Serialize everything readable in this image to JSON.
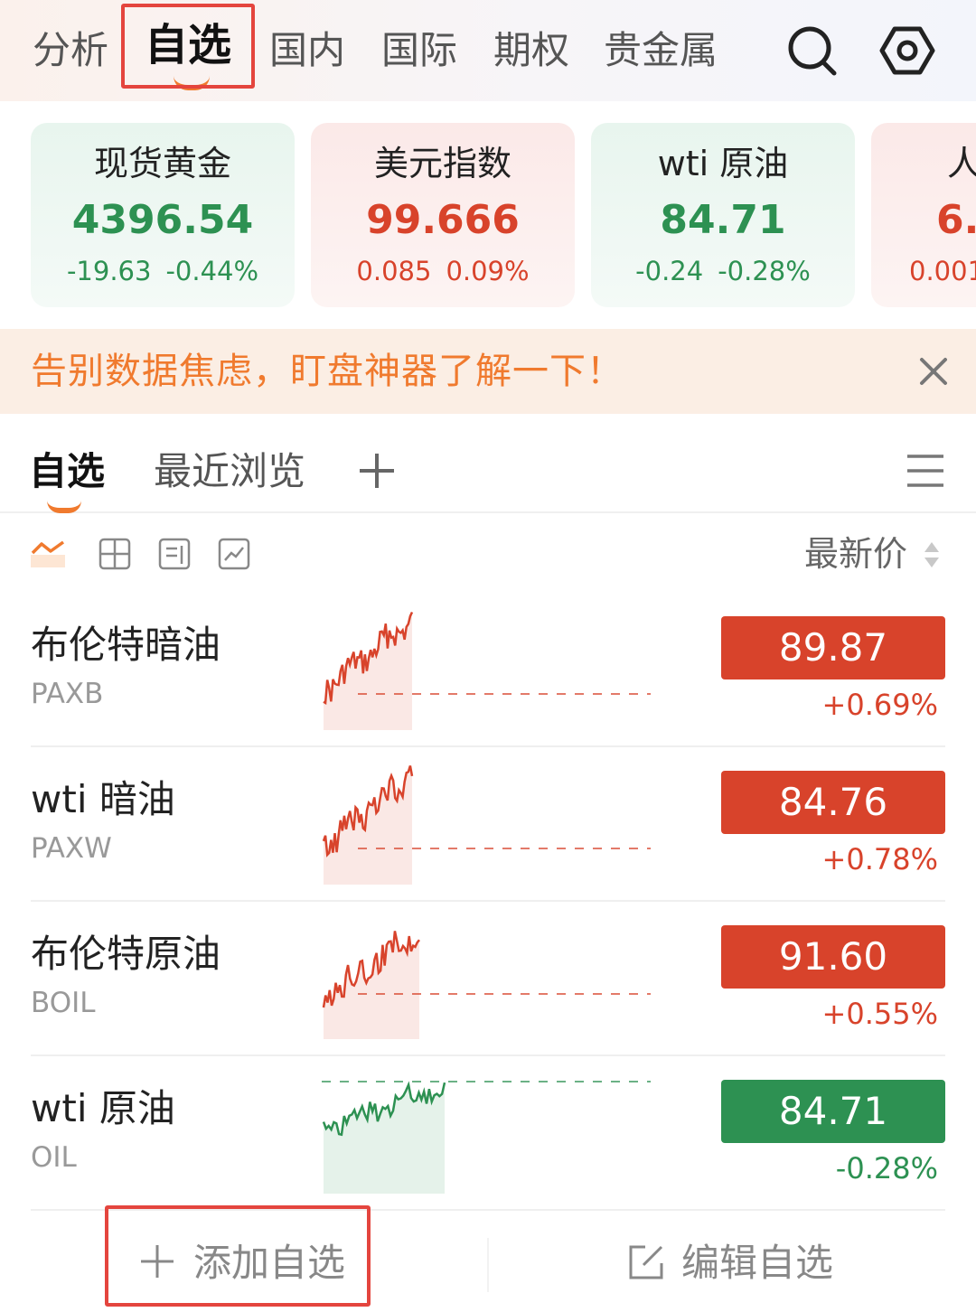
{
  "top_nav": {
    "tabs": [
      "分析",
      "自选",
      "国内",
      "国际",
      "期权",
      "贵金属"
    ],
    "active_tab": "自选"
  },
  "quote_cards": [
    {
      "name": "现货黄金",
      "value": "4396.54",
      "change": "-19.63",
      "pct": "-0.44%",
      "trend": "down"
    },
    {
      "name": "美元指数",
      "value": "99.666",
      "change": "0.085",
      "pct": "0.09%",
      "trend": "up"
    },
    {
      "name": "wti 原油",
      "value": "84.71",
      "change": "-0.24",
      "pct": "-0.28%",
      "trend": "down"
    },
    {
      "name": "人",
      "value": "6.",
      "change": "0.001",
      "pct": "",
      "trend": "up"
    }
  ],
  "banner": {
    "text": "告别数据焦虑，盯盘神器了解一下！"
  },
  "sub_tabs": {
    "items": [
      "自选",
      "最近浏览"
    ],
    "active": "自选"
  },
  "view_icons": [
    "trend-view-icon",
    "grid-view-icon",
    "card-view-icon",
    "chart-view-icon"
  ],
  "sort": {
    "label": "最新价"
  },
  "watchlist": [
    {
      "name": "布伦特暗油",
      "code": "PAXB",
      "price": "89.87",
      "pct": "+0.69%",
      "trend": "up"
    },
    {
      "name": "wti 暗油",
      "code": "PAXW",
      "price": "84.76",
      "pct": "+0.78%",
      "trend": "up"
    },
    {
      "name": "布伦特原油",
      "code": "BOIL",
      "price": "91.60",
      "pct": "+0.55%",
      "trend": "up"
    },
    {
      "name": "wti 原油",
      "code": "OIL",
      "price": "84.71",
      "pct": "-0.28%",
      "trend": "down"
    }
  ],
  "actions": {
    "add": "添加自选",
    "edit": "编辑自选"
  },
  "colors": {
    "up": "#d8432b",
    "down": "#2d9152",
    "accent": "#f07a2e",
    "highlight": "#e4453e"
  }
}
